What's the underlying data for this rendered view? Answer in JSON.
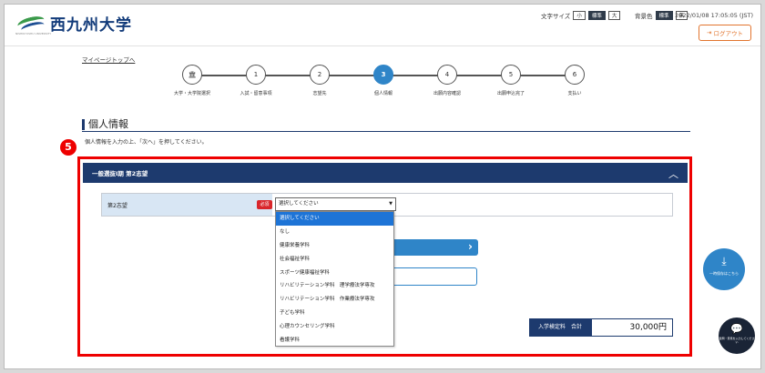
{
  "header": {
    "logo_text": "西九州大学",
    "logo_sub": "NISHIKYUSHU UNIVERSITY",
    "font_size_label": "文字サイズ",
    "font_size_options": [
      "小",
      "標準",
      "大"
    ],
    "bg_color_label": "背景色",
    "bg_color_options": [
      "標準",
      "黒"
    ],
    "datetime": "2022/01/08 17:05:05 (JST)",
    "logout_label": "ログアウト"
  },
  "nav": {
    "mypage_link": "マイページトップへ"
  },
  "steps": [
    {
      "num": "",
      "label": "大学・大学院選択"
    },
    {
      "num": "1",
      "label": "入試・留意事項"
    },
    {
      "num": "2",
      "label": "志望先"
    },
    {
      "num": "3",
      "label": "個人情報"
    },
    {
      "num": "4",
      "label": "出願内容確認"
    },
    {
      "num": "5",
      "label": "出願申込完了"
    },
    {
      "num": "6",
      "label": "支払い"
    }
  ],
  "page": {
    "title": "個人情報",
    "instruction": "個人情報を入力の上、「次へ」を押してください。",
    "annotation_badge": "5"
  },
  "panel": {
    "title": "一般選抜I期 第2志望",
    "field_label": "第2志望",
    "required_label": "必須",
    "select_value": "選択してください",
    "options": [
      "選択してください",
      "なし",
      "健康栄養学科",
      "社会福祉学科",
      "スポーツ健康福祉学科",
      "リハビリテーション学科　理学療法学専攻",
      "リハビリテーション学科　作業療法学専攻",
      "子ども学科",
      "心理カウンセリング学科",
      "看護学科"
    ]
  },
  "fee": {
    "label": "入学検定料　合計",
    "value": "30,000円"
  },
  "floating": {
    "save_label": "一時保存はこちら",
    "chat_label": "質問・意見を入力してください"
  }
}
